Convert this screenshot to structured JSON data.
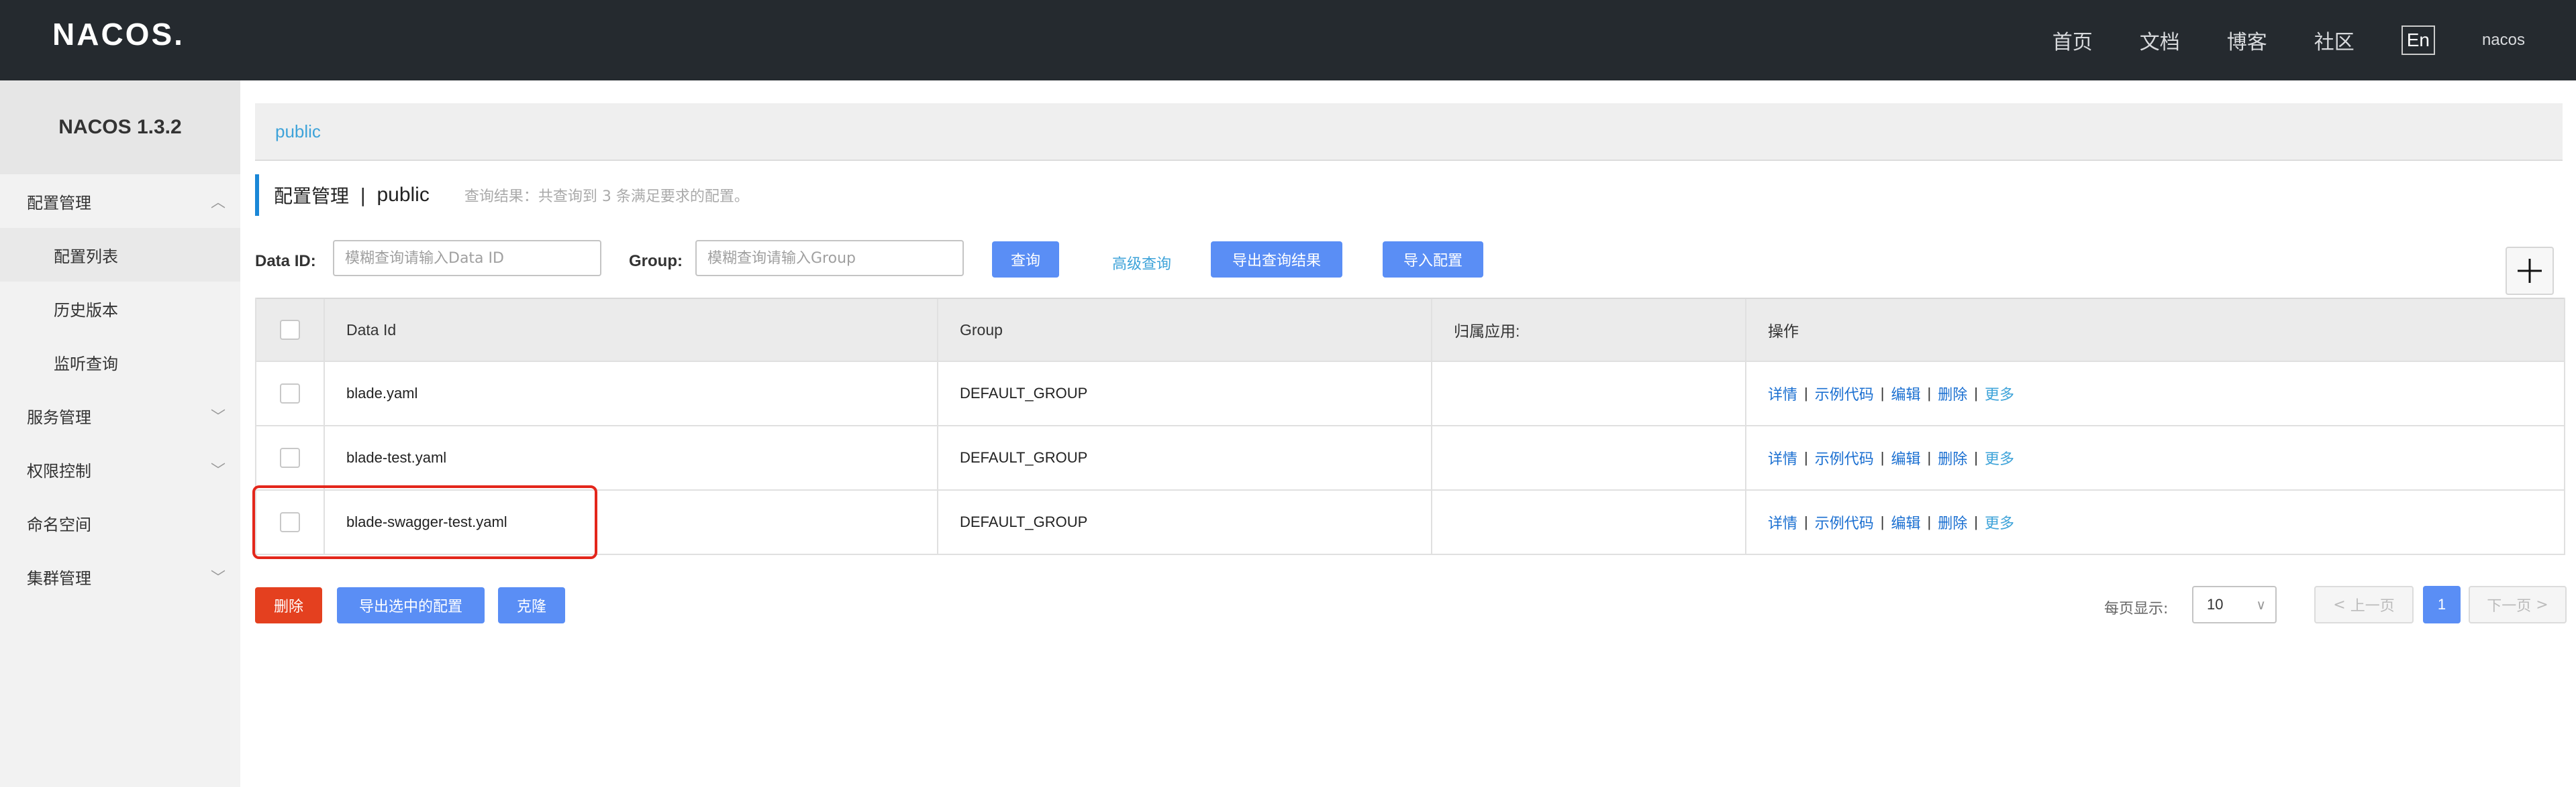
{
  "header": {
    "logo": "NACOS.",
    "nav": [
      "首页",
      "文档",
      "博客",
      "社区"
    ],
    "lang": "En",
    "user": "nacos"
  },
  "sidebar": {
    "title": "NACOS 1.3.2",
    "items": [
      {
        "label": "配置管理",
        "level": 1,
        "expanded": true
      },
      {
        "label": "配置列表",
        "level": 2,
        "selected": true
      },
      {
        "label": "历史版本",
        "level": 2
      },
      {
        "label": "监听查询",
        "level": 2
      },
      {
        "label": "服务管理",
        "level": 1,
        "expanded": false
      },
      {
        "label": "权限控制",
        "level": 1,
        "expanded": false
      },
      {
        "label": "命名空间",
        "level": 1
      },
      {
        "label": "集群管理",
        "level": 1,
        "expanded": false
      }
    ]
  },
  "breadcrumb": "public",
  "page_header": {
    "title": "配置管理",
    "separator": "|",
    "namespace": "public",
    "hint": "查询结果：共查询到 3 条满足要求的配置。"
  },
  "filters": {
    "data_id_label": "Data ID:",
    "data_id_placeholder": "模糊查询请输入Data ID",
    "group_label": "Group:",
    "group_placeholder": "模糊查询请输入Group",
    "query_btn": "查询",
    "advanced_link": "高级查询",
    "export_btn": "导出查询结果",
    "import_btn": "导入配置"
  },
  "table": {
    "columns": [
      "Data Id",
      "Group",
      "归属应用:",
      "操作"
    ],
    "rows": [
      {
        "data_id": "blade.yaml",
        "group": "DEFAULT_GROUP",
        "app": ""
      },
      {
        "data_id": "blade-test.yaml",
        "group": "DEFAULT_GROUP",
        "app": ""
      },
      {
        "data_id": "blade-swagger-test.yaml",
        "group": "DEFAULT_GROUP",
        "app": ""
      }
    ],
    "ops": [
      "详情",
      "示例代码",
      "编辑",
      "删除",
      "更多"
    ],
    "op_sep": "|"
  },
  "bottom": {
    "delete_btn": "删除",
    "export_selected_btn": "导出选中的配置",
    "clone_btn": "克隆",
    "page_size_label": "每页显示:",
    "page_size": "10",
    "prev": "上一页",
    "current_page": "1",
    "next": "下一页"
  },
  "colors": {
    "topbar": "#252a2f",
    "primary": "#5a8ef5",
    "danger": "#e4401f",
    "link": "#1a6fd1",
    "highlight": "#e3261b"
  }
}
